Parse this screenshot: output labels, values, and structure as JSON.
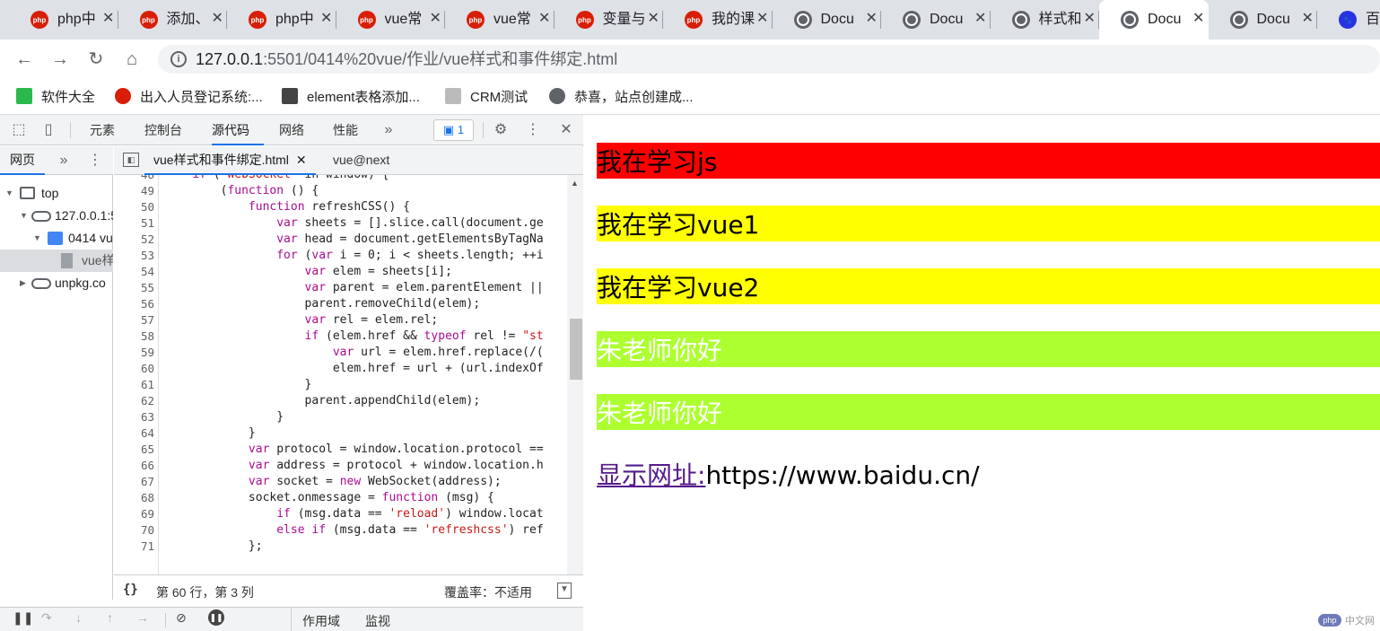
{
  "tabs": [
    {
      "title": "php中",
      "icon": "php"
    },
    {
      "title": "添加、",
      "icon": "php"
    },
    {
      "title": "php中",
      "icon": "php"
    },
    {
      "title": "vue常",
      "icon": "php"
    },
    {
      "title": "vue常",
      "icon": "php"
    },
    {
      "title": "变量与",
      "icon": "php"
    },
    {
      "title": "我的课",
      "icon": "php"
    },
    {
      "title": "Docu",
      "icon": "globe"
    },
    {
      "title": "Docu",
      "icon": "globe"
    },
    {
      "title": "样式和",
      "icon": "globe"
    },
    {
      "title": "Docu",
      "icon": "globe",
      "active": true
    },
    {
      "title": "Docu",
      "icon": "globe"
    },
    {
      "title": "百度",
      "icon": "baidu"
    }
  ],
  "omnibox": {
    "host": "127.0.0.1",
    "rest": ":5501/0414%20vue/作业/vue样式和事件绑定.html"
  },
  "bookmarks": [
    {
      "label": "软件大全",
      "icon": "download-icon"
    },
    {
      "label": "出入人员登记系统:...",
      "icon": "record-icon"
    },
    {
      "label": "element表格添加...",
      "icon": "element-icon"
    },
    {
      "label": "CRM测试",
      "icon": "file-icon"
    },
    {
      "label": "恭喜，站点创建成...",
      "icon": "globe-icon"
    }
  ],
  "devtools": {
    "tabs": {
      "elements": "元素",
      "console": "控制台",
      "sources": "源代码",
      "network": "网络",
      "performance": "性能"
    },
    "issues_count": "1",
    "navigator": {
      "tab_page": "网页",
      "tree": [
        {
          "label": "top"
        },
        {
          "label": "127.0.0.1:5"
        },
        {
          "label": "0414 vu"
        },
        {
          "label": "vue样"
        },
        {
          "label": "unpkg.co"
        }
      ]
    },
    "editor": {
      "active_file": "vue样式和事件绑定.html",
      "second_file": "vue@next"
    },
    "status": {
      "position": "第 60 行，第 3 列",
      "coverage": "覆盖率：不适用",
      "pretty": "{}"
    },
    "debugbar": {
      "scope": "作用域",
      "watch": "监视"
    }
  },
  "code_lines": [
    {
      "n": "48",
      "t": "    if ('WebSocket' in window) {"
    },
    {
      "n": "49",
      "t": "        (function () {"
    },
    {
      "n": "50",
      "t": "            function refreshCSS() {"
    },
    {
      "n": "51",
      "t": "                var sheets = [].slice.call(document.ge"
    },
    {
      "n": "52",
      "t": "                var head = document.getElementsByTagNa"
    },
    {
      "n": "53",
      "t": "                for (var i = 0; i < sheets.length; ++i"
    },
    {
      "n": "54",
      "t": "                    var elem = sheets[i];"
    },
    {
      "n": "55",
      "t": "                    var parent = elem.parentElement ||"
    },
    {
      "n": "56",
      "t": "                    parent.removeChild(elem);"
    },
    {
      "n": "57",
      "t": "                    var rel = elem.rel;"
    },
    {
      "n": "58",
      "t": "                    if (elem.href && typeof rel != \"st"
    },
    {
      "n": "59",
      "t": "                        var url = elem.href.replace(/("
    },
    {
      "n": "60",
      "t": "                        elem.href = url + (url.indexOf"
    },
    {
      "n": "61",
      "t": "                    }"
    },
    {
      "n": "62",
      "t": "                    parent.appendChild(elem);"
    },
    {
      "n": "63",
      "t": "                }"
    },
    {
      "n": "64",
      "t": "            }"
    },
    {
      "n": "65",
      "t": "            var protocol = window.location.protocol =="
    },
    {
      "n": "66",
      "t": "            var address = protocol + window.location.h"
    },
    {
      "n": "67",
      "t": "            var socket = new WebSocket(address);"
    },
    {
      "n": "68",
      "t": "            socket.onmessage = function (msg) {"
    },
    {
      "n": "69",
      "t": "                if (msg.data == 'reload') window.locat"
    },
    {
      "n": "70",
      "t": "                else if (msg.data == 'refreshcss') ref"
    },
    {
      "n": "71",
      "t": "            };"
    }
  ],
  "page": {
    "bars": [
      {
        "text": "我在学习js",
        "bg": "#ff0000",
        "color": "#000000"
      },
      {
        "text": "我在学习vue1",
        "bg": "#ffff00",
        "color": "#000000"
      },
      {
        "text": "我在学习vue2",
        "bg": "#ffff00",
        "color": "#000000"
      },
      {
        "text": "朱老师你好",
        "bg": "#adff2f",
        "color": "#ffffff"
      },
      {
        "text": "朱老师你好",
        "bg": "#adff2f",
        "color": "#ffffff"
      }
    ],
    "link_label": "显示网址:",
    "link_value": "https://www.baidu.cn/",
    "watermark_logo": "php",
    "watermark_text": "中文网"
  }
}
